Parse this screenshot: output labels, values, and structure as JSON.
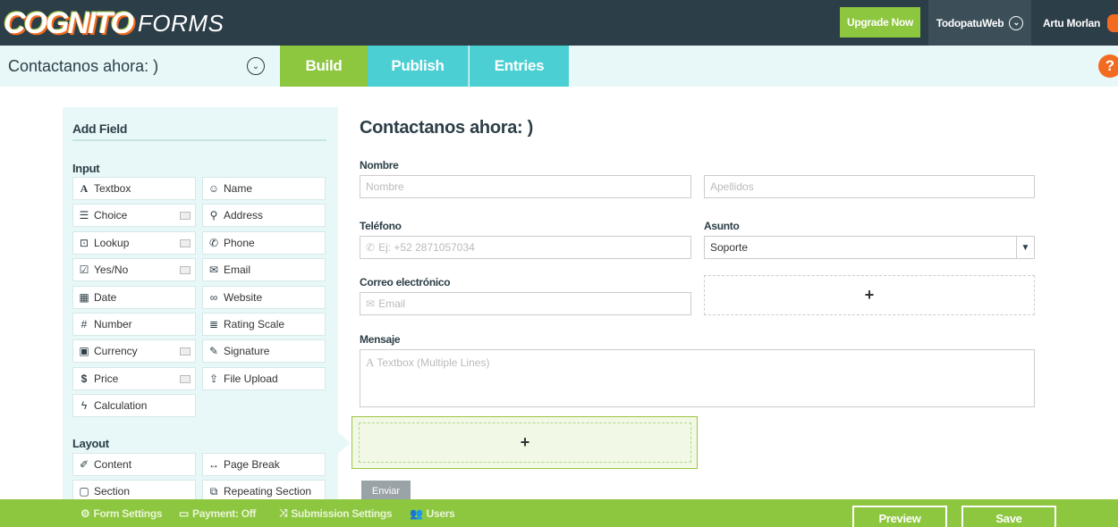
{
  "app": {
    "logo_main": "COGNITO",
    "logo_sub": "FORMS",
    "upgrade_label": "Upgrade Now",
    "org_name": "TodopatuWeb",
    "user_name": "Artu Morlan"
  },
  "subbar": {
    "form_title": "Contactanos ahora: )",
    "tabs": [
      {
        "label": "Build",
        "active": true
      },
      {
        "label": "Publish",
        "active": false
      },
      {
        "label": "Entries",
        "active": false
      }
    ],
    "help": "?"
  },
  "add_field": {
    "title": "Add Field",
    "input_label": "Input",
    "layout_label": "Layout",
    "input_fields": [
      {
        "label": "Textbox",
        "icon": "A"
      },
      {
        "label": "Name",
        "icon": "☺"
      },
      {
        "label": "Choice",
        "icon": "☰"
      },
      {
        "label": "Address",
        "icon": "⚲"
      },
      {
        "label": "Lookup",
        "icon": "⊡"
      },
      {
        "label": "Phone",
        "icon": "✆"
      },
      {
        "label": "Yes/No",
        "icon": "☑"
      },
      {
        "label": "Email",
        "icon": "✉"
      },
      {
        "label": "Date",
        "icon": "▦"
      },
      {
        "label": "Website",
        "icon": "∞"
      },
      {
        "label": "Number",
        "icon": "#"
      },
      {
        "label": "Rating Scale",
        "icon": "≣"
      },
      {
        "label": "Currency",
        "icon": "▣"
      },
      {
        "label": "Signature",
        "icon": "✎"
      },
      {
        "label": "Price",
        "icon": "$"
      },
      {
        "label": "File Upload",
        "icon": "⇪"
      },
      {
        "label": "Calculation",
        "icon": "ϟ"
      }
    ],
    "layout_fields": [
      {
        "label": "Content",
        "icon": "✐"
      },
      {
        "label": "Page Break",
        "icon": "↔"
      },
      {
        "label": "Section",
        "icon": "▢"
      },
      {
        "label": "Repeating Section",
        "icon": "⧉"
      }
    ]
  },
  "form": {
    "heading": "Contactanos ahora: )",
    "nombre_label": "Nombre",
    "nombre_placeholder": "Nombre",
    "apellidos_placeholder": "Apellidos",
    "telefono_label": "Teléfono",
    "telefono_placeholder": "Ej: +52 2871057034",
    "asunto_label": "Asunto",
    "asunto_value": "Soporte",
    "correo_label": "Correo electrónico",
    "correo_placeholder": "Email",
    "mensaje_label": "Mensaje",
    "mensaje_placeholder": "Textbox (Multiple Lines)",
    "add_symbol": "+",
    "submit_label": "Enviar"
  },
  "bottombar": {
    "form_settings": "Form Settings",
    "payment": "Payment: Off",
    "submission_settings": "Submission Settings",
    "users": "Users",
    "preview": "Preview",
    "save": "Save"
  }
}
